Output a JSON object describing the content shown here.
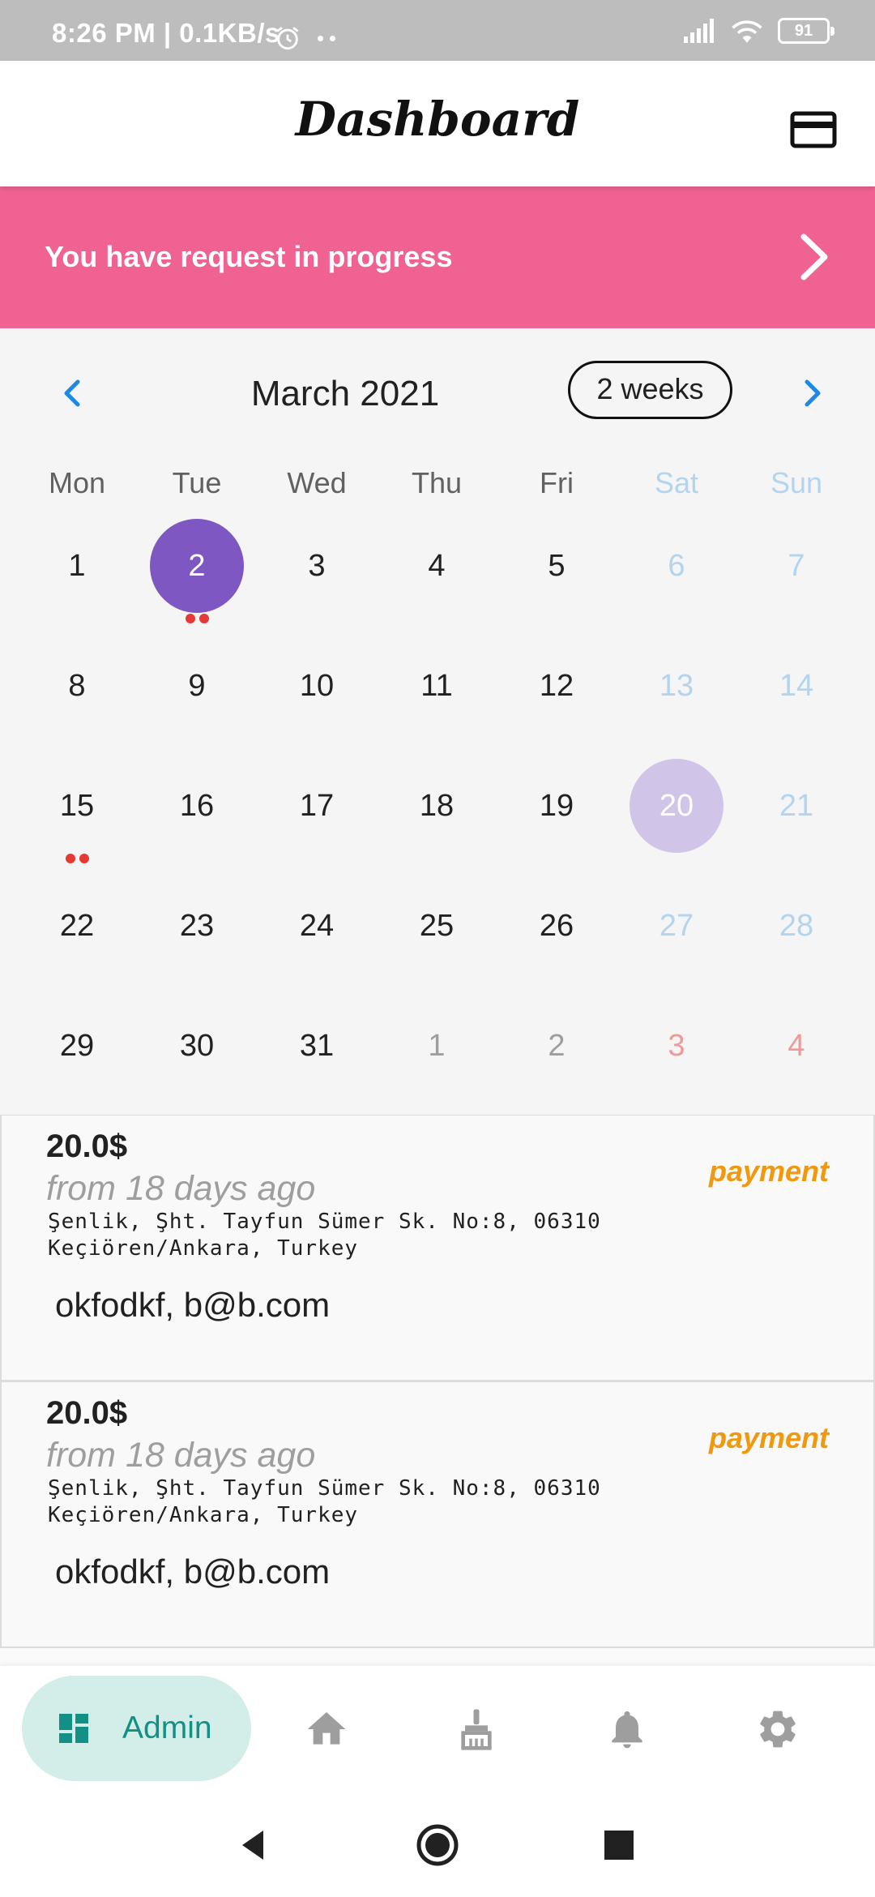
{
  "status_bar": {
    "time": "8:26 PM | 0.1KB/s",
    "battery": "91"
  },
  "app_bar": {
    "title": "Dashboard"
  },
  "banner": {
    "text": "You have request in progress"
  },
  "calendar": {
    "month_title": "March 2021",
    "format_button": "2 weeks",
    "weekdays": [
      "Mon",
      "Tue",
      "Wed",
      "Thu",
      "Fri",
      "Sat",
      "Sun"
    ],
    "weeks": [
      [
        "1",
        "2",
        "3",
        "4",
        "5",
        "6",
        "7"
      ],
      [
        "8",
        "9",
        "10",
        "11",
        "12",
        "13",
        "14"
      ],
      [
        "15",
        "16",
        "17",
        "18",
        "19",
        "20",
        "21"
      ],
      [
        "22",
        "23",
        "24",
        "25",
        "26",
        "27",
        "28"
      ],
      [
        "29",
        "30",
        "31",
        "1",
        "2",
        "3",
        "4"
      ]
    ],
    "selected_day": "2",
    "today": "20",
    "days_with_events": [
      "2",
      "15"
    ],
    "next_month_days": [
      "1",
      "2",
      "3",
      "4"
    ],
    "colors": {
      "selected": "#7e57c2",
      "today": "#d1c4e9",
      "event_marker": "#e53935",
      "weekend": "#b3d4ee",
      "outside_weekend": "#ef9a9a"
    }
  },
  "requests": [
    {
      "price": "20.0$",
      "time": "from 18 days ago",
      "type": "payment",
      "address_line1": "Şenlik, Şht. Tayfun Sümer Sk. No:8, 06310",
      "address_line2": "Keçiören/Ankara, Turkey",
      "contact": "okfodkf, b@b.com"
    },
    {
      "price": "20.0$",
      "time": "from 18 days ago",
      "type": "payment",
      "address_line1": "Şenlik, Şht. Tayfun Sümer Sk. No:8, 06310",
      "address_line2": "Keçiören/Ankara, Turkey",
      "contact": "okfodkf, b@b.com"
    }
  ],
  "bottom_nav": {
    "active_label": "Admin",
    "items": [
      "dashboard-icon",
      "home-icon",
      "cleaning-brush-icon",
      "bell-icon",
      "gear-icon"
    ],
    "active_color": "#138f86"
  }
}
